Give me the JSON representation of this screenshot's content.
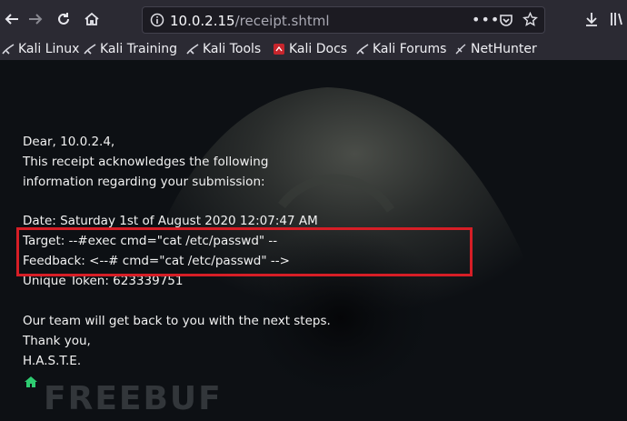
{
  "toolbar": {
    "url_host": "10.0.2.15",
    "url_path": "/receipt.shtml"
  },
  "bookmarks": [
    {
      "label": "Kali Linux"
    },
    {
      "label": "Kali Training"
    },
    {
      "label": "Kali Tools"
    },
    {
      "label": "Kali Docs"
    },
    {
      "label": "Kali Forums"
    },
    {
      "label": "NetHunter"
    }
  ],
  "receipt": {
    "greeting": "Dear, 10.0.2.4,",
    "line1": "This receipt acknowledges the following",
    "line2": "information regarding your submission:",
    "date": "Date: Saturday 1st of August 2020 12:07:47 AM",
    "target": "Target: --#exec cmd=\"cat /etc/passwd\" --",
    "feedback": "Feedback: <--# cmd=\"cat /etc/passwd\" -->",
    "token": "Unique Token: 623339751",
    "followup": "Our team will get back to you with the next steps.",
    "thanks": "Thank you,",
    "signature": "H.A.S.T.E."
  },
  "watermark": "FREEBUF",
  "colors": {
    "highlight_box": "#d61e26",
    "toolbar_bg": "#2b2a33",
    "home_icon": "#2ecc71"
  }
}
